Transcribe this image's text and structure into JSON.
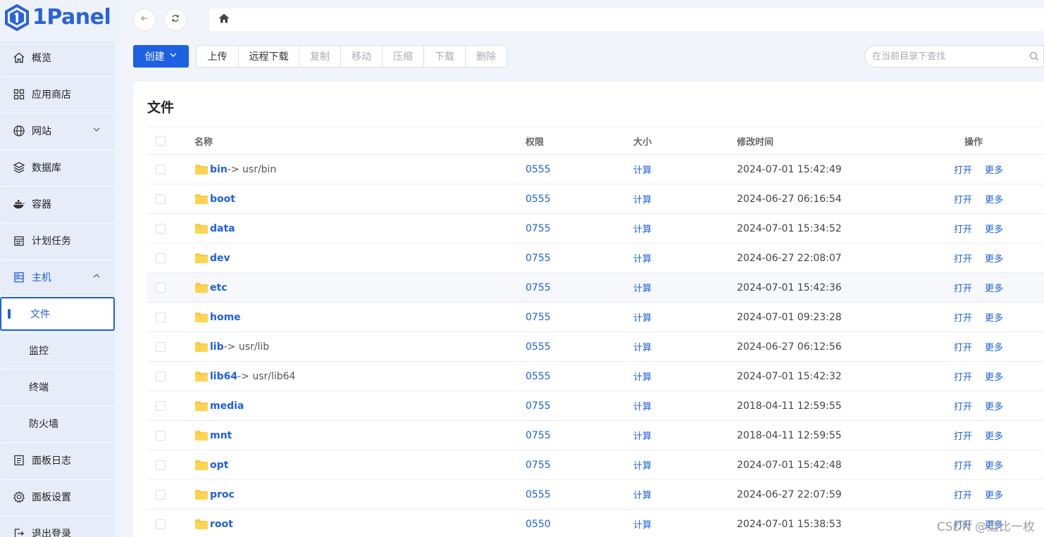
{
  "app": {
    "logo_text": "1Panel"
  },
  "sidebar": {
    "items": [
      {
        "label": "概览",
        "icon": "home-icon"
      },
      {
        "label": "应用商店",
        "icon": "apps-grid-icon"
      },
      {
        "label": "网站",
        "icon": "globe-icon",
        "expandable": true
      },
      {
        "label": "数据库",
        "icon": "database-layers-icon"
      },
      {
        "label": "容器",
        "icon": "docker-whale-icon"
      },
      {
        "label": "计划任务",
        "icon": "calendar-icon"
      },
      {
        "label": "主机",
        "icon": "server-icon",
        "expanded": true
      },
      {
        "label": "文件",
        "sub": true,
        "active": true
      },
      {
        "label": "监控",
        "sub": true
      },
      {
        "label": "终端",
        "sub": true
      },
      {
        "label": "防火墙",
        "sub": true
      },
      {
        "label": "面板日志",
        "icon": "log-icon"
      },
      {
        "label": "面板设置",
        "icon": "gear-icon"
      },
      {
        "label": "退出登录",
        "icon": "logout-icon"
      }
    ]
  },
  "toolbar": {
    "create_label": "创建",
    "buttons": [
      {
        "label": "上传",
        "enabled": true
      },
      {
        "label": "远程下载",
        "enabled": true
      },
      {
        "label": "复制",
        "enabled": false
      },
      {
        "label": "移动",
        "enabled": false
      },
      {
        "label": "压缩",
        "enabled": false
      },
      {
        "label": "下载",
        "enabled": false
      },
      {
        "label": "删除",
        "enabled": false
      }
    ],
    "search_placeholder": "在当前目录下查找"
  },
  "main": {
    "title": "文件",
    "columns": {
      "name": "名称",
      "perm": "权限",
      "size": "大小",
      "time": "修改时间",
      "op": "操作"
    },
    "size_action": "计算",
    "op_open": "打开",
    "op_more": "更多",
    "rows": [
      {
        "name": "bin",
        "link": "-> usr/bin",
        "perm": "0555",
        "time": "2024-07-01 15:42:49"
      },
      {
        "name": "boot",
        "link": "",
        "perm": "0555",
        "time": "2024-06-27 06:16:54"
      },
      {
        "name": "data",
        "link": "",
        "perm": "0755",
        "time": "2024-07-01 15:34:52"
      },
      {
        "name": "dev",
        "link": "",
        "perm": "0755",
        "time": "2024-06-27 22:08:07"
      },
      {
        "name": "etc",
        "link": "",
        "perm": "0755",
        "time": "2024-07-01 15:42:36",
        "highlight": true
      },
      {
        "name": "home",
        "link": "",
        "perm": "0755",
        "time": "2024-07-01 09:23:28"
      },
      {
        "name": "lib",
        "link": "-> usr/lib",
        "perm": "0555",
        "time": "2024-06-27 06:12:56"
      },
      {
        "name": "lib64",
        "link": "-> usr/lib64",
        "perm": "0555",
        "time": "2024-07-01 15:42:32"
      },
      {
        "name": "media",
        "link": "",
        "perm": "0755",
        "time": "2018-04-11 12:59:55"
      },
      {
        "name": "mnt",
        "link": "",
        "perm": "0755",
        "time": "2018-04-11 12:59:55"
      },
      {
        "name": "opt",
        "link": "",
        "perm": "0755",
        "time": "2024-07-01 15:42:48"
      },
      {
        "name": "proc",
        "link": "",
        "perm": "0555",
        "time": "2024-06-27 22:07:59"
      },
      {
        "name": "root",
        "link": "",
        "perm": "0550",
        "time": "2024-07-01 15:38:53"
      }
    ]
  },
  "watermark": "CSDN @逗比一枚",
  "colors": {
    "accent": "#1d61e1",
    "folder": "#ffc83d",
    "sidebar_bg": "#eef3fb"
  }
}
